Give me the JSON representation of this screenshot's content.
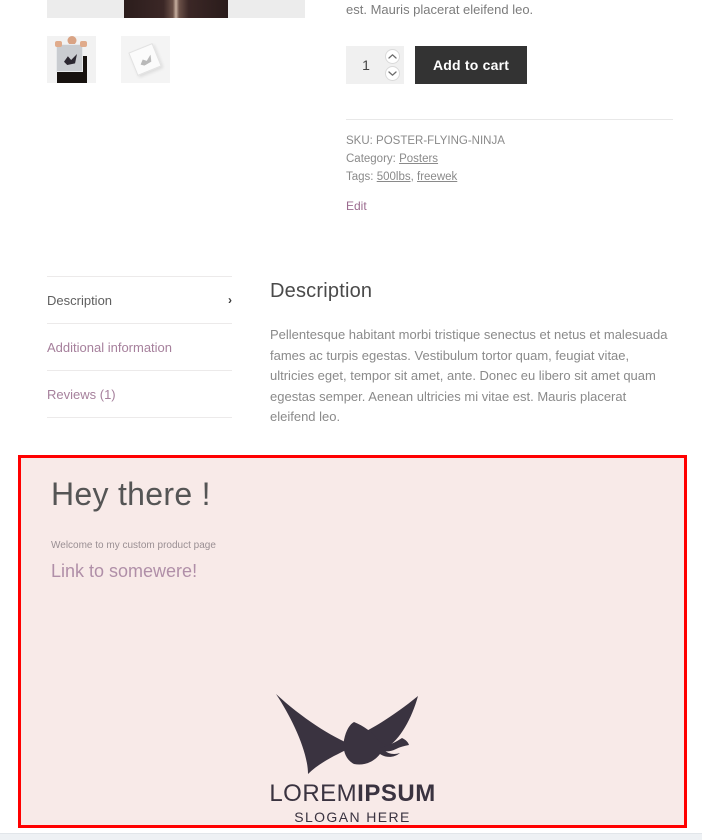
{
  "product": {
    "gallery": {
      "main_image_alt": "product-main-image",
      "thumbnails": [
        {
          "alt": "poster-held-by-person-thumbnail"
        },
        {
          "alt": "blank-poster-angled-thumbnail"
        }
      ]
    },
    "short_description_tail": "est. Mauris placerat eleifend leo.",
    "quantity": {
      "value": "1",
      "placeholder": "1",
      "increase_label": "⌃",
      "decrease_label": "⌄"
    },
    "add_to_cart_label": "Add to cart",
    "meta": {
      "sku_label": "SKU:",
      "sku_value": "POSTER-FLYING-NINJA",
      "category_label": "Category:",
      "category_value": "Posters",
      "tags_label": "Tags:",
      "tags": [
        "500lbs",
        "freewek"
      ],
      "tags_separator": ", "
    },
    "edit_label": "Edit"
  },
  "tabs": {
    "items": [
      {
        "label": "Description",
        "active": true,
        "chevron": "›"
      },
      {
        "label": "Additional information",
        "active": false,
        "chevron": ""
      },
      {
        "label": "Reviews (1)",
        "active": false,
        "chevron": ""
      }
    ],
    "panel": {
      "heading": "Description",
      "body": "Pellentesque habitant morbi tristique senectus et netus et malesuada fames ac turpis egestas. Vestibulum tortor quam, feugiat vitae, ultricies eget, tempor sit amet, ante. Donec eu libero sit amet quam egestas semper. Aenean ultricies mi vitae est. Mauris placerat eleifend leo."
    }
  },
  "custom_section": {
    "heading": "Hey there !",
    "welcome_text": "Welcome to my custom product page",
    "link_text": "Link to somewere!",
    "logo": {
      "brand_light": "LOREM",
      "brand_bold": "IPSUM",
      "slogan": "SLOGAN HERE",
      "mark": "flying-bird-logo-icon"
    },
    "colors": {
      "background": "#f8eae8",
      "border": "#ff0000",
      "heading_text": "#555555",
      "link_text": "#b08fa8",
      "logo_ink": "#3a3340"
    }
  },
  "colors": {
    "add_to_cart_background": "#333333",
    "add_to_cart_text": "#ffffff",
    "quantity_background": "#f0f0f0",
    "body_text": "#8a8a8a",
    "tab_link": "#a6809c",
    "tab_active": "#5f5f5f",
    "edit_link": "#9b6b8f",
    "divider": "#e8e8e8"
  }
}
